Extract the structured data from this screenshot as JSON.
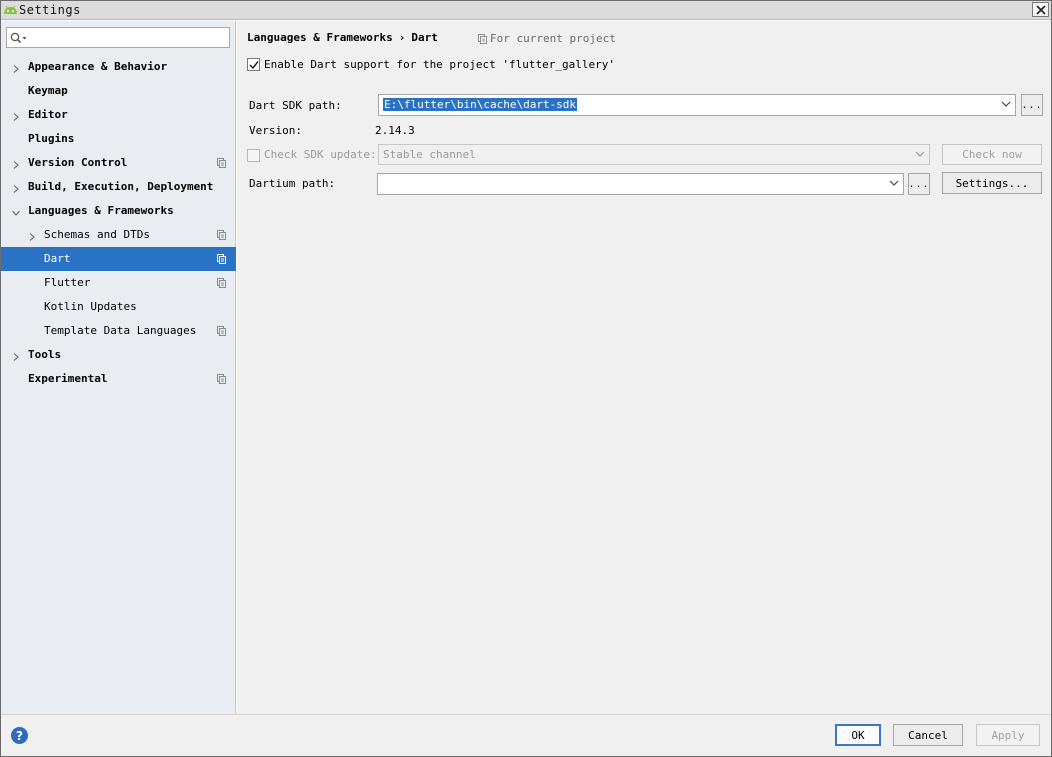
{
  "window": {
    "title": "Settings"
  },
  "sidebar": {
    "search": {
      "value": "",
      "placeholder": ""
    },
    "items": [
      {
        "label": "Appearance & Behavior",
        "level": 0,
        "chevron": "right",
        "project_icon": false,
        "selected": false
      },
      {
        "label": "Keymap",
        "level": 0,
        "chevron": "none",
        "project_icon": false,
        "selected": false
      },
      {
        "label": "Editor",
        "level": 0,
        "chevron": "right",
        "project_icon": false,
        "selected": false
      },
      {
        "label": "Plugins",
        "level": 0,
        "chevron": "none",
        "project_icon": false,
        "selected": false
      },
      {
        "label": "Version Control",
        "level": 0,
        "chevron": "right",
        "project_icon": true,
        "selected": false
      },
      {
        "label": "Build, Execution, Deployment",
        "level": 0,
        "chevron": "right",
        "project_icon": false,
        "selected": false
      },
      {
        "label": "Languages & Frameworks",
        "level": 0,
        "chevron": "down",
        "project_icon": false,
        "selected": false
      },
      {
        "label": "Schemas and DTDs",
        "level": 1,
        "chevron": "right",
        "project_icon": true,
        "selected": false
      },
      {
        "label": "Dart",
        "level": 1,
        "chevron": "none",
        "project_icon": true,
        "selected": true
      },
      {
        "label": "Flutter",
        "level": 1,
        "chevron": "none",
        "project_icon": true,
        "selected": false
      },
      {
        "label": "Kotlin Updates",
        "level": 1,
        "chevron": "none",
        "project_icon": false,
        "selected": false
      },
      {
        "label": "Template Data Languages",
        "level": 1,
        "chevron": "none",
        "project_icon": true,
        "selected": false
      },
      {
        "label": "Tools",
        "level": 0,
        "chevron": "right",
        "project_icon": false,
        "selected": false
      },
      {
        "label": "Experimental",
        "level": 0,
        "chevron": "none",
        "project_icon": true,
        "selected": false
      }
    ]
  },
  "breadcrumb": {
    "parent": "Languages & Frameworks",
    "separator": "›",
    "current": "Dart",
    "scope_note": "For current project"
  },
  "dart": {
    "enable_label": "Enable Dart support for the project 'flutter_gallery'",
    "enable_checked": true,
    "sdk_path_label": "Dart SDK path:",
    "sdk_path_value": "E:\\flutter\\bin\\cache\\dart-sdk",
    "browse_label": "...",
    "version_label": "Version:",
    "version_value": "2.14.3",
    "check_update_label": "Check SDK update:",
    "check_update_checked": false,
    "channel_value": "Stable channel",
    "check_now_label": "Check now",
    "dartium_label": "Dartium path:",
    "dartium_value": "",
    "dartium_browse_label": "...",
    "settings_label": "Settings..."
  },
  "footer": {
    "help_label": "?",
    "ok_label": "OK",
    "cancel_label": "Cancel",
    "apply_label": "Apply"
  },
  "colors": {
    "accent": "#2a72c4",
    "sidebar_bg": "#e9edf1",
    "panel_bg": "#f0f0f0"
  },
  "icons": {
    "app": "android-icon",
    "close": "close-icon",
    "search": "search-icon",
    "project_scope": "project-scope-icon",
    "help": "help-icon"
  }
}
